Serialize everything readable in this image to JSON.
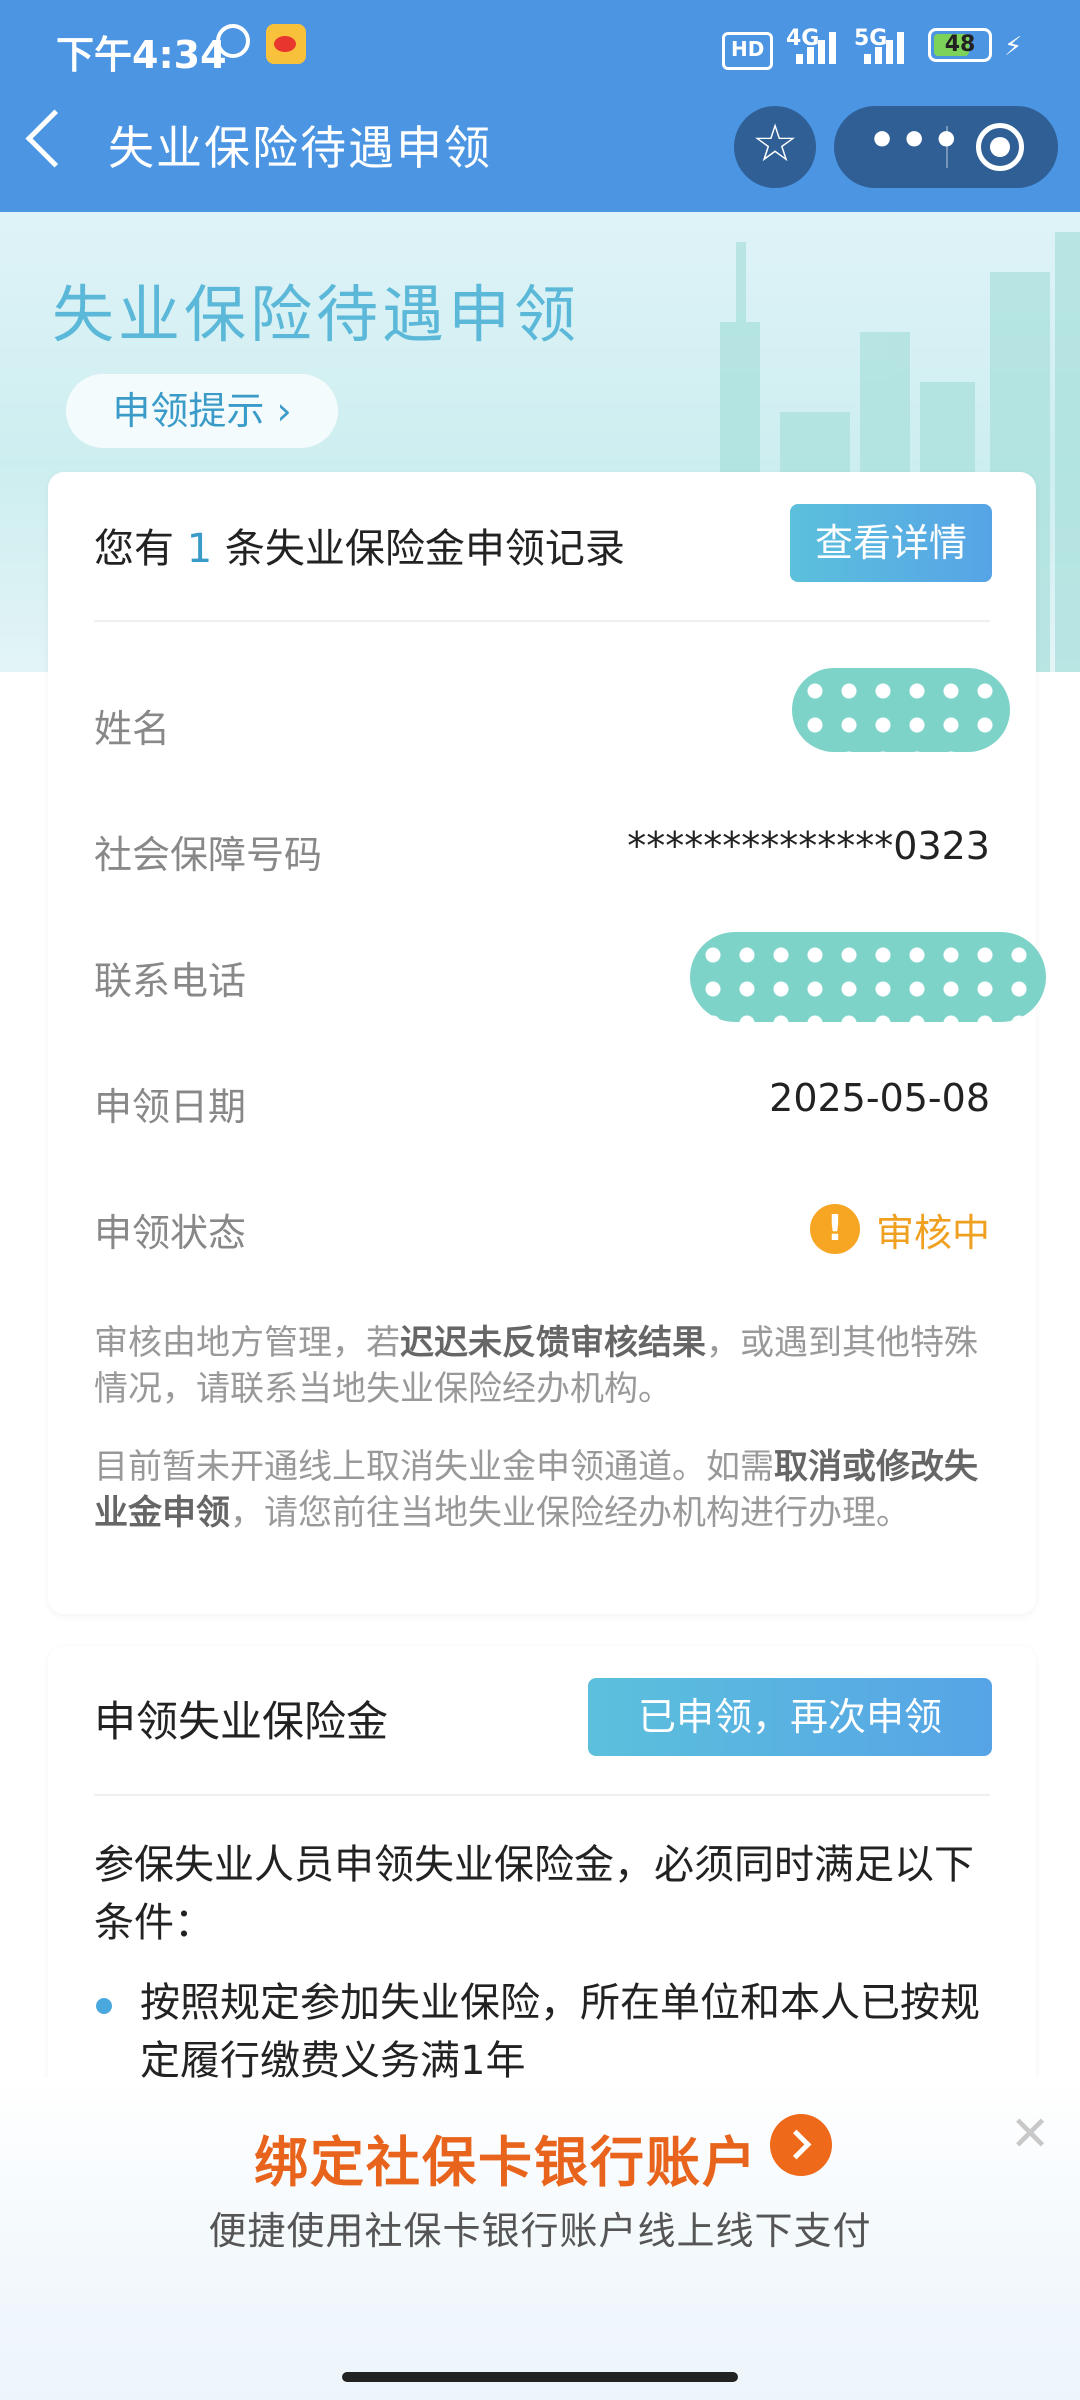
{
  "status_bar": {
    "time": "下午4:34",
    "hd": "HD",
    "net1": "4G",
    "net2": "5G",
    "battery": "48"
  },
  "nav": {
    "title": "失业保险待遇申领"
  },
  "hero": {
    "title": "失业保险待遇申领",
    "tip_label": "申领提示 ›"
  },
  "record_card": {
    "summary_prefix": "您有 ",
    "summary_count": "1",
    "summary_suffix": " 条失业保险金申领记录",
    "detail_button": "查看详情",
    "fields": [
      {
        "label": "姓名",
        "value": ""
      },
      {
        "label": "社会保障号码",
        "value": "**************0323"
      },
      {
        "label": "联系电话",
        "value": ""
      },
      {
        "label": "申领日期",
        "value": "2025-05-08"
      },
      {
        "label": "申领状态",
        "value": "审核中"
      }
    ],
    "note1_a": "审核由地方管理，若",
    "note1_b": "迟迟未反馈审核结果",
    "note1_c": "，或遇到其他特殊情况，请联系当地失业保险经办机构。",
    "note2_a": "目前暂未开通线上取消失业金申领通道。如需",
    "note2_b": "取消或修改失业金申领",
    "note2_c": "，请您前往当地失业保险经办机构进行办理。"
  },
  "apply_card": {
    "title": "申领失业保险金",
    "apply_button": "已申领，再次申领",
    "condition": "参保失业人员申领失业保险金，必须同时满足以下条件：",
    "bullet1": "按照规定参加失业保险，所在单位和本人已按规定履行缴费义务满1年"
  },
  "banner": {
    "title": "绑定社保卡银行账户",
    "subtitle": "便捷使用社保卡银行账户线上线下支付",
    "close": "✕"
  },
  "colors": {
    "nav_bg": "#4b95e3",
    "accent": "#3a9bc9",
    "pending": "#f0a020",
    "banner_title": "#e8641c"
  }
}
